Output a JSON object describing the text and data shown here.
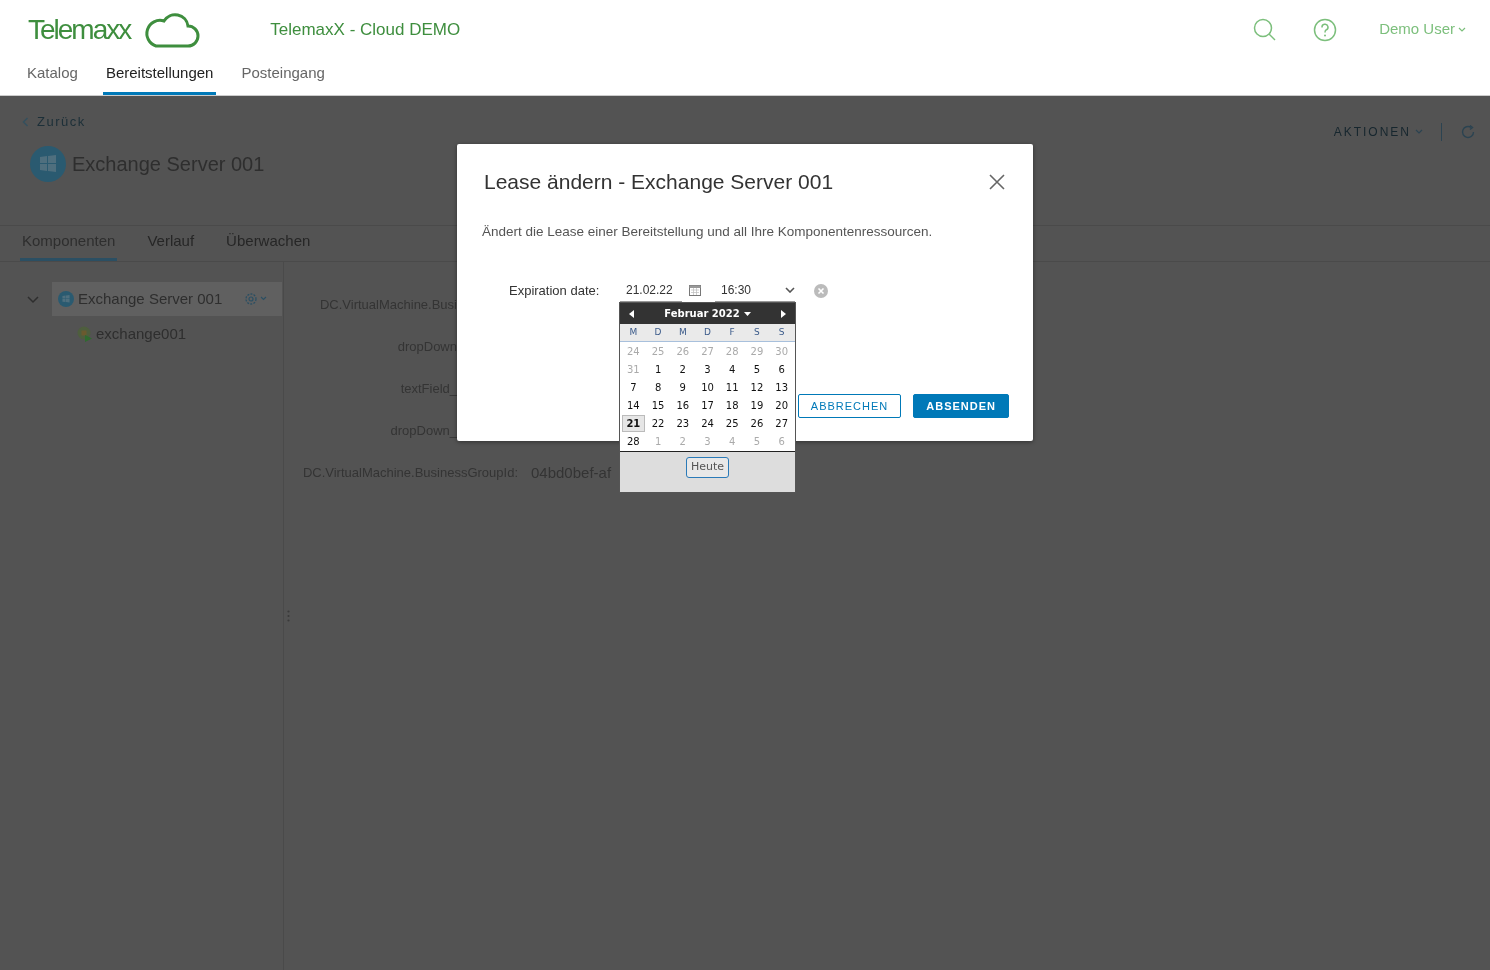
{
  "header": {
    "logo_text": "Telemaxx",
    "app_title": "TelemaxX - Cloud DEMO",
    "user": "Demo User"
  },
  "nav": [
    {
      "label": "Katalog",
      "selected": false
    },
    {
      "label": "Bereitstellungen",
      "selected": true
    },
    {
      "label": "Posteingang",
      "selected": false
    }
  ],
  "page": {
    "back": "Zurück",
    "title": "Exchange Server 001",
    "actions": "AKTIONEN",
    "tabs": [
      {
        "label": "Komponenten",
        "selected": true
      },
      {
        "label": "Verlauf",
        "selected": false
      },
      {
        "label": "Überwachen",
        "selected": false
      }
    ],
    "tree": [
      {
        "label": "Exchange Server 001",
        "expanded": true,
        "selected": true,
        "children": [
          {
            "label": "exchange001"
          }
        ]
      }
    ],
    "properties": [
      {
        "label": "DC.VirtualMachine.Busi"
      },
      {
        "label": "dropDown"
      },
      {
        "label": "textField_"
      },
      {
        "label": "dropDown_"
      },
      {
        "label": "DC.VirtualMachine.BusinessGroupId:",
        "value": "04bd0bef-af"
      }
    ]
  },
  "dialog": {
    "title": "Lease ändern - Exchange Server 001",
    "description": "Ändert die Lease einer Bereitstellung und all Ihre Komponentenressourcen.",
    "expiration_label": "Expiration date:",
    "date_value": "21.02.22",
    "time_value": "16:30",
    "buttons": [
      {
        "label": "ABBRECHEN",
        "kind": "secondary"
      },
      {
        "label": "ABSENDEN",
        "kind": "primary"
      }
    ]
  },
  "calendar": {
    "month_label": "Februar 2022",
    "weekdays": [
      "M",
      "D",
      "M",
      "D",
      "F",
      "S",
      "S"
    ],
    "weeks": [
      [
        {
          "day": "24",
          "outside": true,
          "selected": false
        },
        {
          "day": "25",
          "outside": true,
          "selected": false
        },
        {
          "day": "26",
          "outside": true,
          "selected": false
        },
        {
          "day": "27",
          "outside": true,
          "selected": false
        },
        {
          "day": "28",
          "outside": true,
          "selected": false
        },
        {
          "day": "29",
          "outside": true,
          "selected": false
        },
        {
          "day": "30",
          "outside": true,
          "selected": false
        }
      ],
      [
        {
          "day": "31",
          "outside": true,
          "selected": false
        },
        {
          "day": "1",
          "outside": false,
          "selected": false
        },
        {
          "day": "2",
          "outside": false,
          "selected": false
        },
        {
          "day": "3",
          "outside": false,
          "selected": false
        },
        {
          "day": "4",
          "outside": false,
          "selected": false
        },
        {
          "day": "5",
          "outside": false,
          "selected": false
        },
        {
          "day": "6",
          "outside": false,
          "selected": false
        }
      ],
      [
        {
          "day": "7",
          "outside": false,
          "selected": false
        },
        {
          "day": "8",
          "outside": false,
          "selected": false
        },
        {
          "day": "9",
          "outside": false,
          "selected": false
        },
        {
          "day": "10",
          "outside": false,
          "selected": false
        },
        {
          "day": "11",
          "outside": false,
          "selected": false
        },
        {
          "day": "12",
          "outside": false,
          "selected": false
        },
        {
          "day": "13",
          "outside": false,
          "selected": false
        }
      ],
      [
        {
          "day": "14",
          "outside": false,
          "selected": false
        },
        {
          "day": "15",
          "outside": false,
          "selected": false
        },
        {
          "day": "16",
          "outside": false,
          "selected": false
        },
        {
          "day": "17",
          "outside": false,
          "selected": false
        },
        {
          "day": "18",
          "outside": false,
          "selected": false
        },
        {
          "day": "19",
          "outside": false,
          "selected": false
        },
        {
          "day": "20",
          "outside": false,
          "selected": false
        }
      ],
      [
        {
          "day": "21",
          "outside": false,
          "selected": true
        },
        {
          "day": "22",
          "outside": false,
          "selected": false
        },
        {
          "day": "23",
          "outside": false,
          "selected": false
        },
        {
          "day": "24",
          "outside": false,
          "selected": false
        },
        {
          "day": "25",
          "outside": false,
          "selected": false
        },
        {
          "day": "26",
          "outside": false,
          "selected": false
        },
        {
          "day": "27",
          "outside": false,
          "selected": false
        }
      ],
      [
        {
          "day": "28",
          "outside": false,
          "selected": false
        },
        {
          "day": "1",
          "outside": true,
          "selected": false
        },
        {
          "day": "2",
          "outside": true,
          "selected": false
        },
        {
          "day": "3",
          "outside": true,
          "selected": false
        },
        {
          "day": "4",
          "outside": true,
          "selected": false
        },
        {
          "day": "5",
          "outside": true,
          "selected": false
        },
        {
          "day": "6",
          "outside": true,
          "selected": false
        }
      ]
    ],
    "today_button": "Heute"
  }
}
